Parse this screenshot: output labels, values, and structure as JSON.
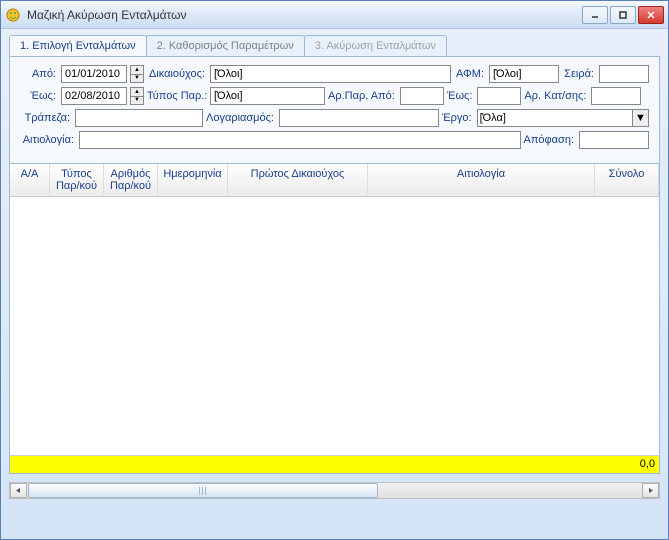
{
  "window": {
    "title": "Μαζική Ακύρωση Ενταλμάτων"
  },
  "tabs": [
    {
      "label": "1. Επιλογή Ενταλμάτων",
      "active": true
    },
    {
      "label": "2. Καθορισμός Παραμέτρων",
      "active": false
    },
    {
      "label": "3. Ακύρωση Ενταλμάτων",
      "active": false,
      "disabled": true
    }
  ],
  "filters": {
    "apo_label": "Από:",
    "apo_value": "01/01/2010",
    "eos_label": "Έως:",
    "eos_value": "02/08/2010",
    "dikaiouxos_label": "Δικαιούχος:",
    "dikaiouxos_value": "[Όλοι]",
    "typos_par_label": "Τύπος Παρ.:",
    "typos_par_value": "[Όλοι]",
    "afm_label": "ΑΦΜ:",
    "afm_value": "[Όλοι]",
    "seira_label": "Σειρά:",
    "seira_value": "",
    "ar_par_apo_label": "Αρ.Παρ. Από:",
    "ar_par_apo_value": "",
    "eos2_label": "Έως:",
    "eos2_value": "",
    "ar_katsis_label": "Αρ. Κατ/σης:",
    "ar_katsis_value": "",
    "trapeza_label": "Τράπεζα:",
    "trapeza_value": "",
    "logariasmos_label": "Λογαριασμός:",
    "logariasmos_value": "",
    "ergo_label": "Έργο:",
    "ergo_value": "[Όλα]",
    "aitiologia_label": "Αιτιολογία:",
    "aitiologia_value": "",
    "apofasi_label": "Απόφαση:",
    "apofasi_value": ""
  },
  "table": {
    "headers": {
      "aa": "Α/Α",
      "typos": "Τύπος Παρ/κού",
      "arithmos": "Αριθμός Παρ/κού",
      "imerominia": "Ημερομηνία",
      "protos": "Πρώτος Δικαιούχος",
      "aitiologia": "Αιτιολογία",
      "sinolo": "Σύνολο"
    },
    "rows": []
  },
  "footer": {
    "total": "0,0"
  }
}
